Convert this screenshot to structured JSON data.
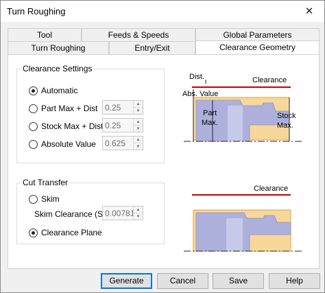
{
  "window": {
    "title": "Turn Roughing",
    "close_glyph": "✕"
  },
  "tabs": {
    "row1": [
      {
        "label": "Tool"
      },
      {
        "label": "Feeds & Speeds"
      },
      {
        "label": "Global Parameters"
      }
    ],
    "row2": [
      {
        "label": "Turn Roughing"
      },
      {
        "label": "Entry/Exit"
      },
      {
        "label": "Clearance Geometry",
        "active": true
      }
    ]
  },
  "clearance_settings": {
    "title": "Clearance Settings",
    "options": [
      {
        "label": "Automatic",
        "checked": true
      },
      {
        "label": "Part Max + Dist",
        "checked": false,
        "value": "0.25"
      },
      {
        "label": "Stock Max + Dist",
        "checked": false,
        "value": "0.25"
      },
      {
        "label": "Absolute Value",
        "checked": false,
        "value": "0.625"
      }
    ]
  },
  "cut_transfer": {
    "title": "Cut Transfer",
    "skim_label": "Skim",
    "skim_checked": false,
    "skim_clearance_label": "Skim Clearance (S)",
    "skim_clearance_value": "0.00781",
    "clearance_plane_label": "Clearance Plane",
    "clearance_plane_checked": true
  },
  "diagram_top": {
    "dist": "Dist.",
    "clearance": "Clearance",
    "abs_value": "Abs. Value",
    "part": "Part",
    "max1": "Max.",
    "stock": "Stock",
    "max2": "Max."
  },
  "diagram_bottom": {
    "clearance": "Clearance"
  },
  "buttons": {
    "generate": "Generate",
    "cancel": "Cancel",
    "save": "Save",
    "help": "Help"
  },
  "colors": {
    "clearance_line": "#c00000",
    "stock": "#f7d79a",
    "stock_border": "#e0a040",
    "part": "#aeb0dc",
    "part_light": "#c7c9ea",
    "accent": "#0078d7"
  }
}
